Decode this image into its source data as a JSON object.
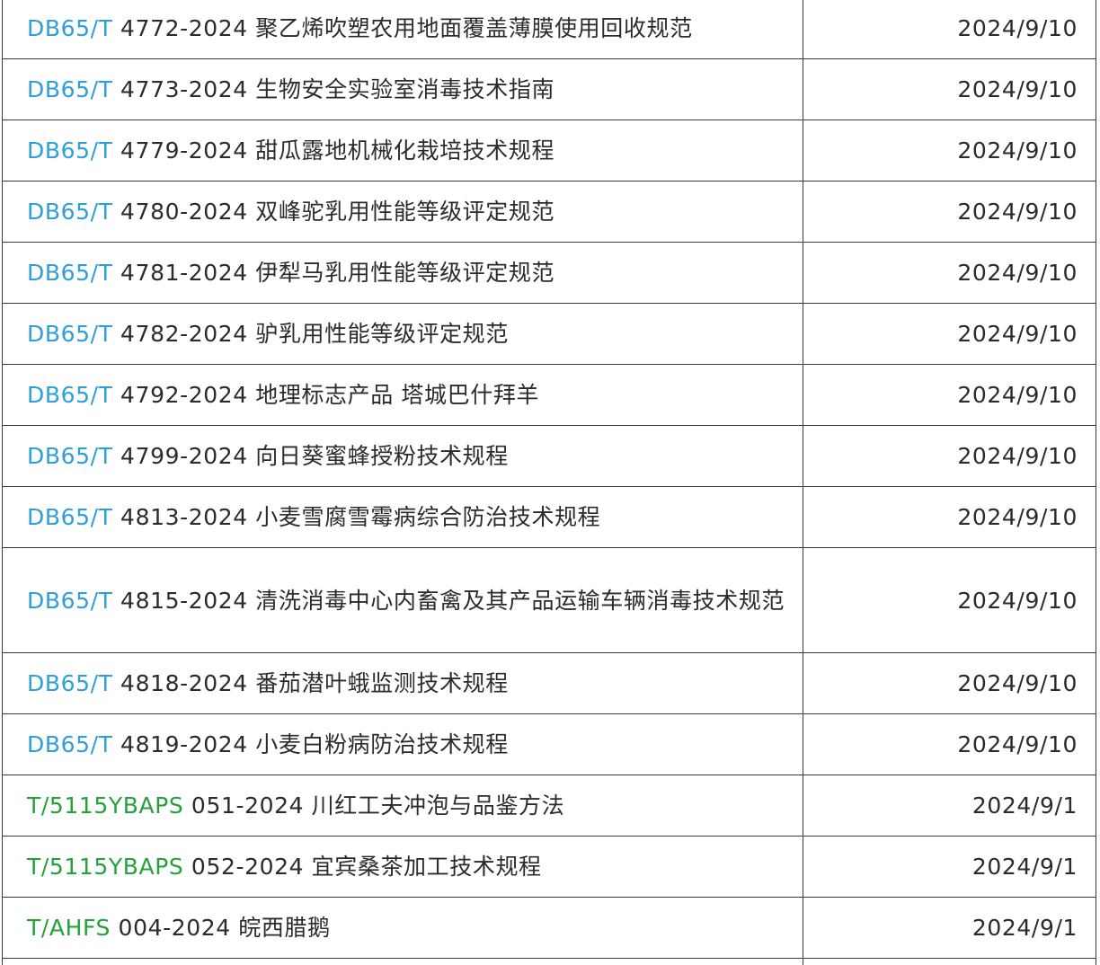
{
  "colors": {
    "db_prefix": "#2ea0d8",
    "t_prefix": "#24a23a",
    "text": "#2b2b2b",
    "border": "#3a3a3a"
  },
  "rows": [
    {
      "prefix": "DB65/T",
      "rest": " 4772-2024 聚乙烯吹塑农用地面覆盖薄膜使用回收规范",
      "date": "2024/9/10"
    },
    {
      "prefix": "DB65/T",
      "rest": " 4773-2024 生物安全实验室消毒技术指南",
      "date": "2024/9/10"
    },
    {
      "prefix": "DB65/T",
      "rest": " 4779-2024 甜瓜露地机械化栽培技术规程",
      "date": "2024/9/10"
    },
    {
      "prefix": "DB65/T",
      "rest": " 4780-2024 双峰驼乳用性能等级评定规范",
      "date": "2024/9/10"
    },
    {
      "prefix": "DB65/T",
      "rest": " 4781-2024 伊犁马乳用性能等级评定规范",
      "date": "2024/9/10"
    },
    {
      "prefix": "DB65/T",
      "rest": " 4782-2024 驴乳用性能等级评定规范",
      "date": "2024/9/10"
    },
    {
      "prefix": "DB65/T",
      "rest": " 4792-2024 地理标志产品 塔城巴什拜羊",
      "date": "2024/9/10"
    },
    {
      "prefix": "DB65/T",
      "rest": " 4799-2024 向日葵蜜蜂授粉技术规程",
      "date": "2024/9/10"
    },
    {
      "prefix": "DB65/T",
      "rest": " 4813-2024 小麦雪腐雪霉病综合防治技术规程",
      "date": "2024/9/10"
    },
    {
      "prefix": "DB65/T",
      "rest": " 4815-2024 清洗消毒中心内畜禽及其产品运输车辆消毒技术规范",
      "date": "2024/9/10"
    },
    {
      "prefix": "DB65/T",
      "rest": " 4818-2024 番茄潜叶蛾监测技术规程",
      "date": "2024/9/10"
    },
    {
      "prefix": "DB65/T",
      "rest": " 4819-2024 小麦白粉病防治技术规程",
      "date": "2024/9/10"
    },
    {
      "prefix": "T/5115YBAPS",
      "rest": " 051-2024 川红工夫冲泡与品鉴方法",
      "date": "2024/9/1"
    },
    {
      "prefix": "T/5115YBAPS",
      "rest": " 052-2024 宜宾桑茶加工技术规程",
      "date": "2024/9/1"
    },
    {
      "prefix": "T/AHFS",
      "rest": " 004-2024 皖西腊鹅",
      "date": "2024/9/1"
    }
  ]
}
